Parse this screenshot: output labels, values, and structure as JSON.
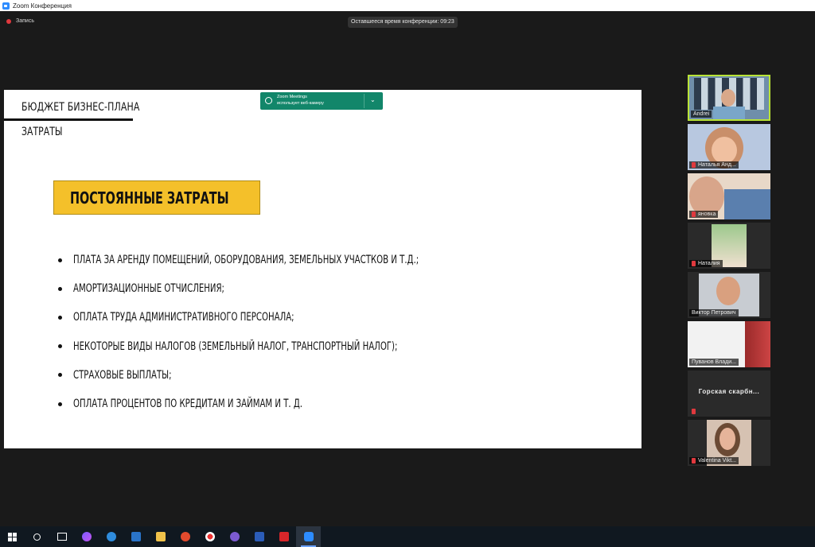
{
  "window": {
    "title": "Zoom Конференция"
  },
  "toolbar": {
    "recording_label": "Запись",
    "remaining_time": "Оставшееся время конференции: 09:23"
  },
  "slide": {
    "title": "БЮДЖЕТ БИЗНЕС-ПЛАНА",
    "subtitle": "ЗАТРАТЫ",
    "heading": "ПОСТОЯННЫЕ ЗАТРАТЫ",
    "bullets": [
      "ПЛАТА ЗА АРЕНДУ ПОМЕЩЕНИЙ, ОБОРУДОВАНИЯ, ЗЕМЕЛЬНЫХ УЧАСТКОВ И Т.Д.;",
      "АМОРТИЗАЦИОННЫЕ ОТЧИСЛЕНИЯ;",
      "ОПЛАТА ТРУДА АДМИНИСТРАТИВНОГО ПЕРСОНАЛА;",
      "НЕКОТОРЫЕ ВИДЫ НАЛОГОВ (ЗЕМЕЛЬНЫЙ НАЛОГ, ТРАНСПОРТНЫЙ НАЛОГ);",
      "СТРАХОВЫЕ ВЫПЛАТЫ;",
      "ОПЛАТА ПРОЦЕНТОВ ПО КРЕДИТАМ И ЗАЙМАМ И Т. Д."
    ]
  },
  "notification": {
    "app": "Zoom Meetings",
    "message": "использует веб-камеру"
  },
  "participants": [
    {
      "name": "Andrei",
      "active": true
    },
    {
      "name": "Наталья Анд...",
      "muted": true
    },
    {
      "name": "яновка",
      "muted": true
    },
    {
      "name": "Наталия",
      "muted": true
    },
    {
      "name": "Виктор Петрович",
      "muted": false
    },
    {
      "name": "Пуванов Влади...",
      "muted": false
    },
    {
      "name": "Горская скарбн...",
      "muted": true,
      "no_video": true
    },
    {
      "name": "Valentina Vikt...",
      "muted": true
    }
  ],
  "taskbar": {
    "icons": [
      "windows-start-icon",
      "search-icon",
      "task-view-icon",
      "alice-icon",
      "edge-icon",
      "mail-icon",
      "file-explorer-icon",
      "media-icon",
      "yandex-browser-icon",
      "viber-icon",
      "word-icon",
      "acrobat-icon",
      "zoom-icon"
    ],
    "colors": {
      "accent": "#6aa0ff",
      "slide_heading_bg": "#f4c02a",
      "active_speaker": "#b9e336",
      "notification_bg": "#12866a"
    }
  }
}
